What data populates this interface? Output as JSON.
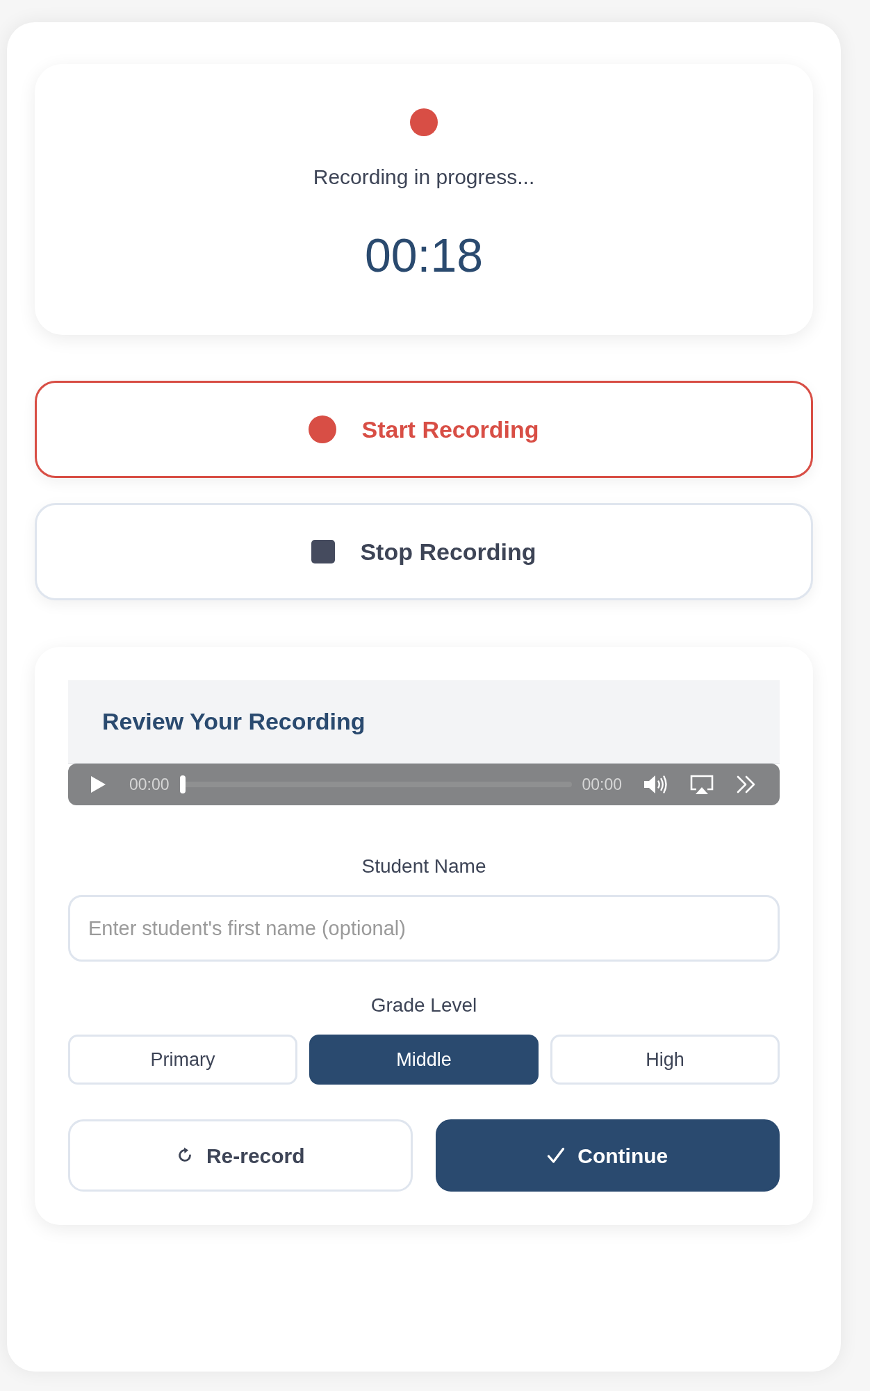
{
  "status": {
    "recording": true,
    "message": "Recording in progress...",
    "elapsed": "00:18"
  },
  "controls": [
    {
      "kind": "start",
      "label": "Start Recording"
    },
    {
      "kind": "stop",
      "label": "Stop Recording"
    }
  ],
  "review": {
    "title": "Review Your Recording",
    "player": {
      "current_time": "00:00",
      "level": 0,
      "duration": "00:00"
    },
    "student_name": {
      "label": "Student Name",
      "placeholder": "Enter student's first name (optional)"
    },
    "grade_level": {
      "label": "Grade Level",
      "options": [
        {
          "label": "Primary",
          "selected": false
        },
        {
          "label": "Middle",
          "selected": true
        },
        {
          "label": "High",
          "selected": false
        }
      ]
    },
    "actions": [
      {
        "kind": "rerecord",
        "label": "Re-record"
      },
      {
        "kind": "continue",
        "label": "Continue"
      }
    ]
  }
}
